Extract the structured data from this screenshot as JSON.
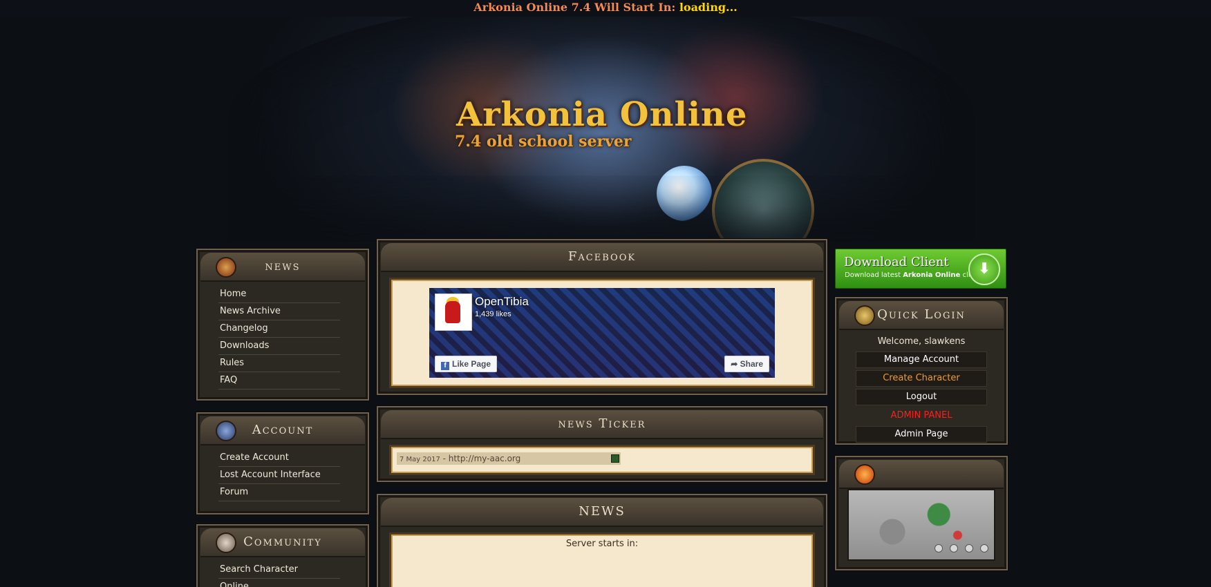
{
  "topbar": {
    "label": "Arkonia Online 7.4 Will Start In:",
    "value": "loading..."
  },
  "header": {
    "title": "Arkonia Online",
    "subtitle": "7.4 old school server"
  },
  "left": {
    "news": {
      "title": "news",
      "items": [
        "Home",
        "News Archive",
        "Changelog",
        "Downloads",
        "Rules",
        "FAQ"
      ]
    },
    "account": {
      "title": "Account",
      "items": [
        "Create Account",
        "Lost Account Interface",
        "Forum"
      ]
    },
    "community": {
      "title": "Community",
      "items": [
        "Search Character",
        "Online"
      ]
    }
  },
  "center": {
    "facebook": {
      "title": "Facebook",
      "page_name": "OpenTibia",
      "likes": "1,439 likes",
      "like_label": "Like Page",
      "share_label": "Share"
    },
    "ticker": {
      "title": "news Ticker",
      "date": "7 May 2017",
      "text": " - http://my-aac.org"
    },
    "news": {
      "title": "NEWS",
      "text": "Server starts in:"
    }
  },
  "right": {
    "download": {
      "title": "Download Client",
      "subtitle_pre": "Download latest",
      "subtitle_brand": "Arkonia Online",
      "subtitle_post": "client"
    },
    "quick_login": {
      "title": "Quick Login",
      "welcome": "Welcome, slawkens",
      "manage": "Manage Account",
      "create": "Create Character",
      "logout": "Logout",
      "admin_panel": "ADMIN PANEL",
      "admin_page": "Admin Page"
    }
  },
  "colors": {
    "countdown_label": "#f58a53",
    "countdown_value": "#ffd800",
    "parchment": "#f5e8cd",
    "admin_red": "#ff1e1e",
    "create_orange": "#f39a2b",
    "download_green": "#4fb61f"
  }
}
